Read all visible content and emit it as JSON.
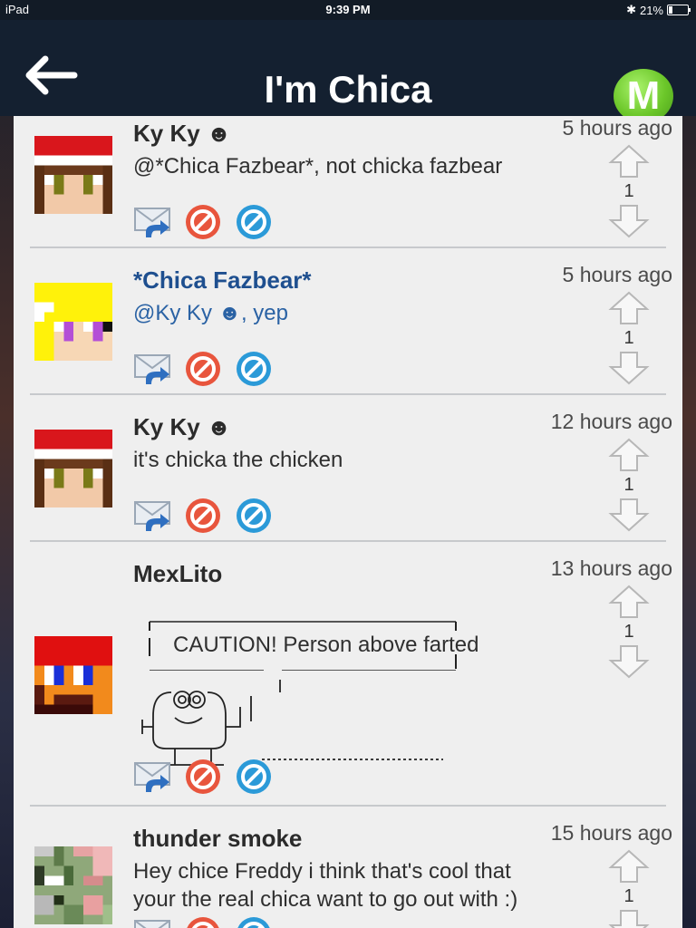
{
  "status_bar": {
    "device": "iPad",
    "time": "9:39 PM",
    "battery": "21%"
  },
  "header": {
    "title": "I'm Chica",
    "logo_letter": "M"
  },
  "posts": [
    {
      "username": "Ky Ky ☻",
      "timestamp": "5 hours ago",
      "message": "@*Chica Fazbear*, not chicka fazbear",
      "votes": "1",
      "avatar": "santa-hat-avatar"
    },
    {
      "username": "*Chica Fazbear*",
      "timestamp": "5 hours ago",
      "message": "@Ky Ky ☻, yep",
      "votes": "1",
      "avatar": "blonde-avatar"
    },
    {
      "username": "Ky Ky ☻",
      "timestamp": "12 hours ago",
      "message": "it's chicka the chicken",
      "votes": "1",
      "avatar": "santa-hat-avatar"
    },
    {
      "username": "MexLito",
      "timestamp": "13 hours ago",
      "message": "CAUTION! Person above farted",
      "votes": "1",
      "avatar": "mario-avatar"
    },
    {
      "username": "thunder smoke",
      "timestamp": "15 hours ago",
      "message_line1": "Hey chice Freddy i think that's cool that",
      "message_line2": "your the real chica want to go out with :)",
      "votes": "1",
      "avatar": "camo-avatar"
    }
  ],
  "colors": {
    "nav_bg": "#142030",
    "username_link": "#1e4f8f",
    "mention": "#2a62a4",
    "logo_green": "#6cc72a"
  }
}
